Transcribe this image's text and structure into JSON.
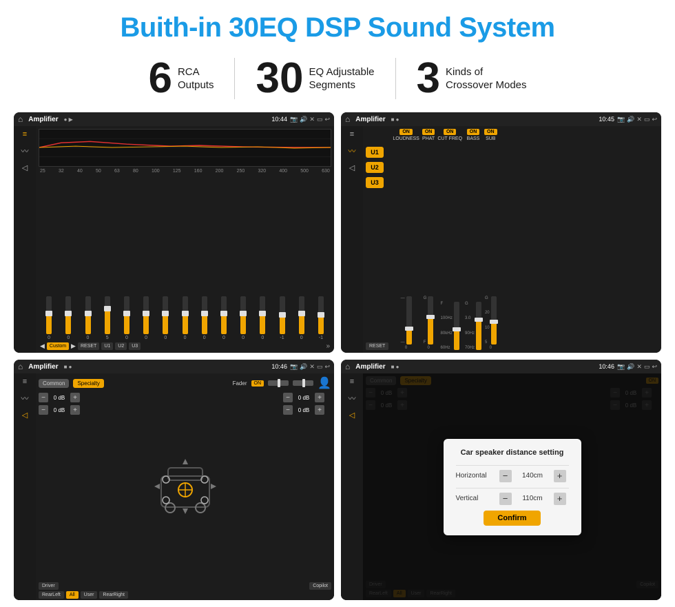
{
  "page": {
    "title": "Buith-in 30EQ DSP Sound System"
  },
  "features": [
    {
      "number": "6",
      "text_line1": "RCA",
      "text_line2": "Outputs"
    },
    {
      "number": "30",
      "text_line1": "EQ Adjustable",
      "text_line2": "Segments"
    },
    {
      "number": "3",
      "text_line1": "Kinds of",
      "text_line2": "Crossover Modes"
    }
  ],
  "screens": {
    "top_left": {
      "title": "Amplifier",
      "time": "10:44",
      "eq_bands": [
        "25",
        "32",
        "40",
        "50",
        "63",
        "80",
        "100",
        "125",
        "160",
        "200",
        "250",
        "320",
        "400",
        "500",
        "630"
      ],
      "eq_values": [
        "0",
        "0",
        "0",
        "5",
        "0",
        "0",
        "0",
        "0",
        "0",
        "0",
        "0",
        "0",
        "-1",
        "0",
        "-1"
      ],
      "buttons": [
        "Custom",
        "RESET",
        "U1",
        "U2",
        "U3"
      ]
    },
    "top_right": {
      "title": "Amplifier",
      "time": "10:45",
      "u_buttons": [
        "U1",
        "U2",
        "U3"
      ],
      "channels": [
        "LOUDNESS",
        "PHAT",
        "CUT FREQ",
        "BASS",
        "SUB"
      ]
    },
    "bottom_left": {
      "title": "Amplifier",
      "time": "10:46",
      "tabs": [
        "Common",
        "Specialty"
      ],
      "fader_label": "Fader",
      "fader_on": "ON",
      "db_left": [
        "0 dB",
        "0 dB"
      ],
      "db_right": [
        "0 dB",
        "0 dB"
      ],
      "bottom_buttons": [
        "Driver",
        "Copilot",
        "RearLeft",
        "All",
        "User",
        "RearRight"
      ]
    },
    "bottom_right": {
      "title": "Amplifier",
      "time": "10:46",
      "dialog": {
        "title": "Car speaker distance setting",
        "horizontal_label": "Horizontal",
        "horizontal_value": "140cm",
        "vertical_label": "Vertical",
        "vertical_value": "110cm",
        "confirm_label": "Confirm"
      }
    }
  }
}
